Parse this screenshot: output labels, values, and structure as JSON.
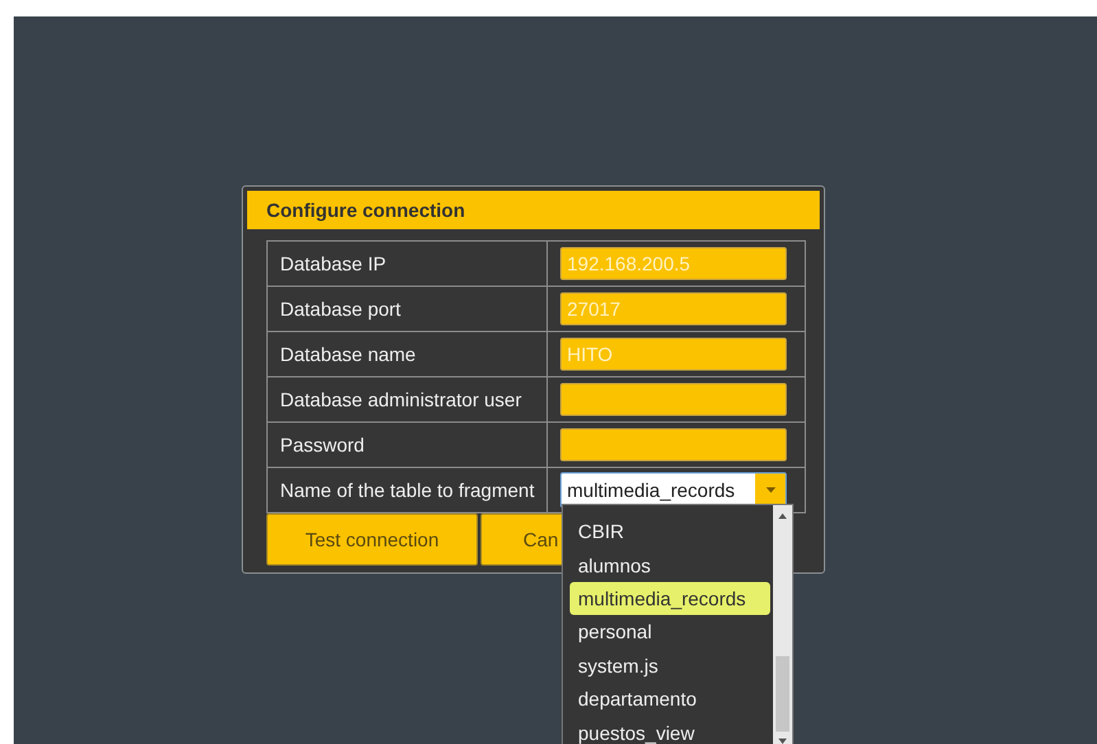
{
  "dialog": {
    "title": "Configure connection",
    "fields": [
      {
        "label": "Database IP",
        "kind": "text",
        "value": "192.168.200.5"
      },
      {
        "label": "Database port",
        "kind": "text",
        "value": "27017"
      },
      {
        "label": "Database name",
        "kind": "text",
        "value": "HITO"
      },
      {
        "label": "Database administrator user",
        "kind": "text"
      },
      {
        "label": "Password",
        "kind": "text"
      },
      {
        "label": "Name of the table to fragment",
        "kind": "select",
        "value": "multimedia_records",
        "expanded": true
      }
    ],
    "buttons": [
      "Test connection",
      "Can"
    ],
    "dropdown": [
      {
        "label": "CBIR",
        "selected": false
      },
      {
        "label": "alumnos",
        "selected": false
      },
      {
        "label": "multimedia_records",
        "selected": true
      },
      {
        "label": "personal",
        "selected": false
      },
      {
        "label": "system.js",
        "selected": false
      },
      {
        "label": "departamento",
        "selected": false
      },
      {
        "label": "puestos_view",
        "selected": false
      }
    ]
  }
}
